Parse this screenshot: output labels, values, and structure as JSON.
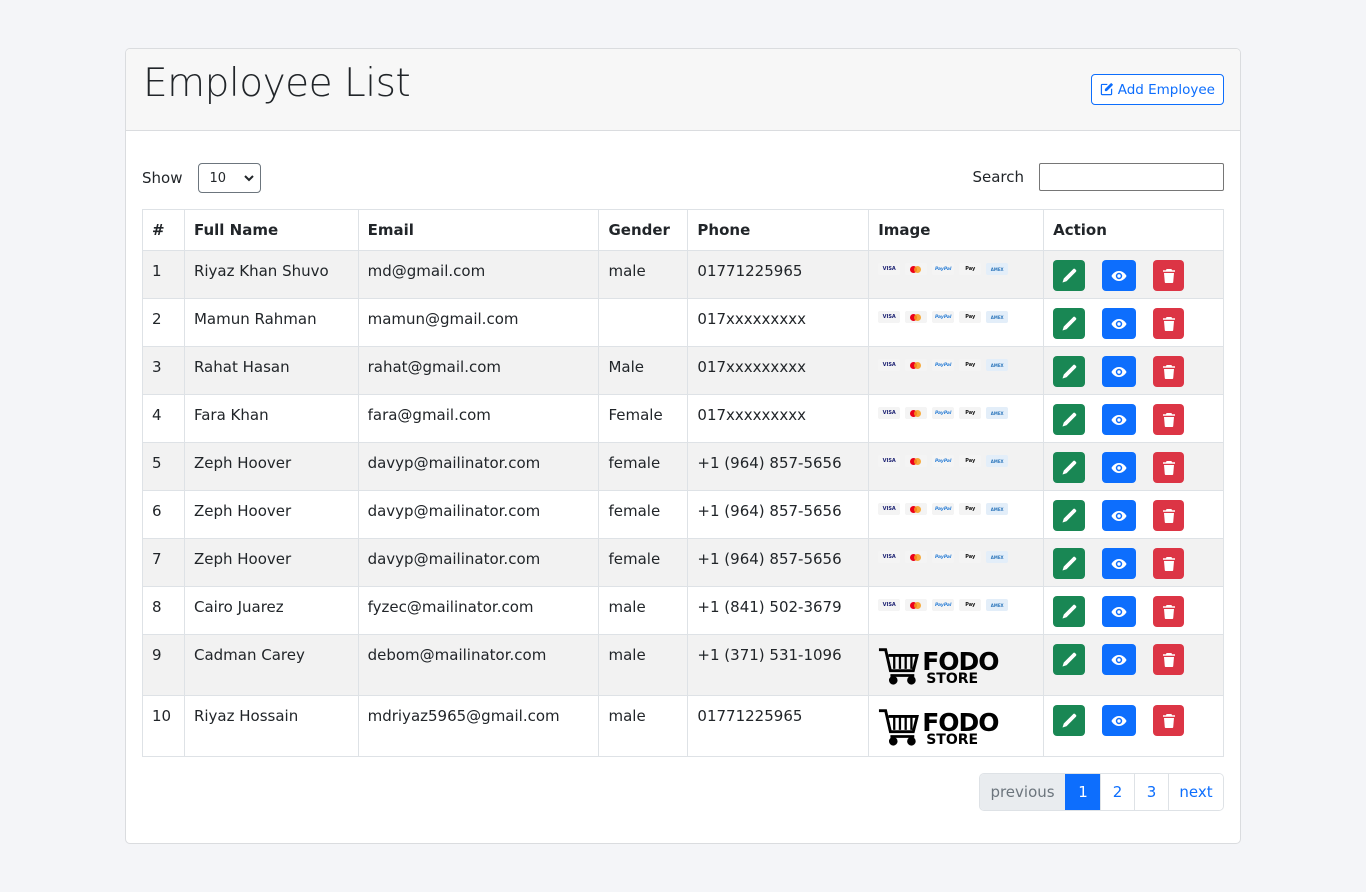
{
  "header": {
    "title": "Employee List",
    "add_button_label": "Add Employee"
  },
  "controls": {
    "show_label": "Show",
    "show_value": "10",
    "search_label": "Search",
    "search_value": ""
  },
  "table": {
    "columns": [
      "#",
      "Full Name",
      "Email",
      "Gender",
      "Phone",
      "Image",
      "Action"
    ],
    "rows": [
      {
        "id": "1",
        "name": "Riyaz Khan Shuvo",
        "email": "md@gmail.com",
        "gender": "male",
        "phone": "01771225965",
        "image": "payment-cards"
      },
      {
        "id": "2",
        "name": "Mamun Rahman",
        "email": "mamun@gmail.com",
        "gender": "",
        "phone": "017xxxxxxxxx",
        "image": "payment-cards"
      },
      {
        "id": "3",
        "name": "Rahat Hasan",
        "email": "rahat@gmail.com",
        "gender": "Male",
        "phone": "017xxxxxxxxx",
        "image": "payment-cards"
      },
      {
        "id": "4",
        "name": "Fara Khan",
        "email": "fara@gmail.com",
        "gender": "Female",
        "phone": "017xxxxxxxxx",
        "image": "payment-cards"
      },
      {
        "id": "5",
        "name": "Zeph Hoover",
        "email": "davyp@mailinator.com",
        "gender": "female",
        "phone": "+1 (964) 857-5656",
        "image": "payment-cards"
      },
      {
        "id": "6",
        "name": "Zeph Hoover",
        "email": "davyp@mailinator.com",
        "gender": "female",
        "phone": "+1 (964) 857-5656",
        "image": "payment-cards"
      },
      {
        "id": "7",
        "name": "Zeph Hoover",
        "email": "davyp@mailinator.com",
        "gender": "female",
        "phone": "+1 (964) 857-5656",
        "image": "payment-cards"
      },
      {
        "id": "8",
        "name": "Cairo Juarez",
        "email": "fyzec@mailinator.com",
        "gender": "male",
        "phone": "+1 (841) 502-3679",
        "image": "payment-cards"
      },
      {
        "id": "9",
        "name": "Cadman Carey",
        "email": "debom@mailinator.com",
        "gender": "male",
        "phone": "+1 (371) 531-1096",
        "image": "fodo-store-logo"
      },
      {
        "id": "10",
        "name": "Riyaz Hossain",
        "email": "mdriyaz5965@gmail.com",
        "gender": "male",
        "phone": "01771225965",
        "image": "fodo-store-logo"
      }
    ]
  },
  "payment_card_labels": [
    "VISA",
    "",
    "PayPal",
    "Pay",
    "AMEX"
  ],
  "fodo_logo": {
    "top": "FODO",
    "bottom": "STORE"
  },
  "pagination": {
    "previous": "previous",
    "pages": [
      "1",
      "2",
      "3"
    ],
    "active": "1",
    "next": "next"
  },
  "icons": {
    "add": "pencil-square-icon",
    "edit": "pencil-icon",
    "view": "eye-icon",
    "delete": "trash-icon"
  },
  "colors": {
    "primary": "#0d6efd",
    "edit": "#198754",
    "delete": "#dc3545"
  }
}
